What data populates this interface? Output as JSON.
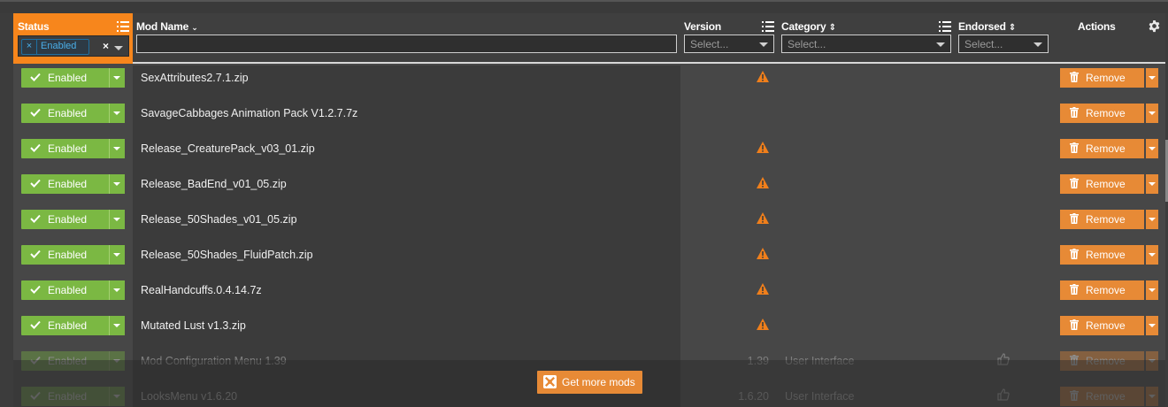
{
  "header": {
    "status_label": "Status",
    "mod_name_label": "Mod Name",
    "version_label": "Version",
    "category_label": "Category",
    "endorsed_label": "Endorsed",
    "actions_label": "Actions",
    "status_filter_chip": "Enabled",
    "mod_name_filter_value": "",
    "version_select_placeholder": "Select...",
    "category_select_placeholder": "Select...",
    "endorsed_select_placeholder": "Select..."
  },
  "colors": {
    "accent_orange": "#f7861c",
    "enabled_green": "#7bb843",
    "remove_orange": "#e78a36"
  },
  "rows": [
    {
      "status": "Enabled",
      "name": "SexAttributes2.7.1.zip",
      "version": "",
      "warning": true,
      "category": "",
      "endorsed": false,
      "action": "Remove"
    },
    {
      "status": "Enabled",
      "name": "SavageCabbages Animation Pack V1.2.7.7z",
      "version": "",
      "warning": false,
      "category": "",
      "endorsed": false,
      "action": "Remove"
    },
    {
      "status": "Enabled",
      "name": "Release_CreaturePack_v03_01.zip",
      "version": "",
      "warning": true,
      "category": "",
      "endorsed": false,
      "action": "Remove"
    },
    {
      "status": "Enabled",
      "name": "Release_BadEnd_v01_05.zip",
      "version": "",
      "warning": true,
      "category": "",
      "endorsed": false,
      "action": "Remove"
    },
    {
      "status": "Enabled",
      "name": "Release_50Shades_v01_05.zip",
      "version": "",
      "warning": true,
      "category": "",
      "endorsed": false,
      "action": "Remove"
    },
    {
      "status": "Enabled",
      "name": "Release_50Shades_FluidPatch.zip",
      "version": "",
      "warning": true,
      "category": "",
      "endorsed": false,
      "action": "Remove"
    },
    {
      "status": "Enabled",
      "name": "RealHandcuffs.0.4.14.7z",
      "version": "",
      "warning": true,
      "category": "",
      "endorsed": false,
      "action": "Remove"
    },
    {
      "status": "Enabled",
      "name": "Mutated Lust v1.3.zip",
      "version": "",
      "warning": true,
      "category": "",
      "endorsed": false,
      "action": "Remove"
    },
    {
      "status": "Enabled",
      "name": "Mod Configuration Menu 1.39",
      "version": "1.39",
      "warning": false,
      "category": "User Interface",
      "endorsed": true,
      "action": "Remove"
    },
    {
      "status": "Enabled",
      "name": "LooksMenu v1.6.20",
      "version": "1.6.20",
      "warning": false,
      "category": "User Interface",
      "endorsed": true,
      "action": "Remove"
    }
  ],
  "get_more_mods_label": "Get more mods",
  "icons": {
    "check": "check-icon",
    "warning": "warning-icon",
    "trash": "trash-icon",
    "thumb": "thumbs-up-icon",
    "gear": "gear-icon",
    "list": "list-icon"
  }
}
